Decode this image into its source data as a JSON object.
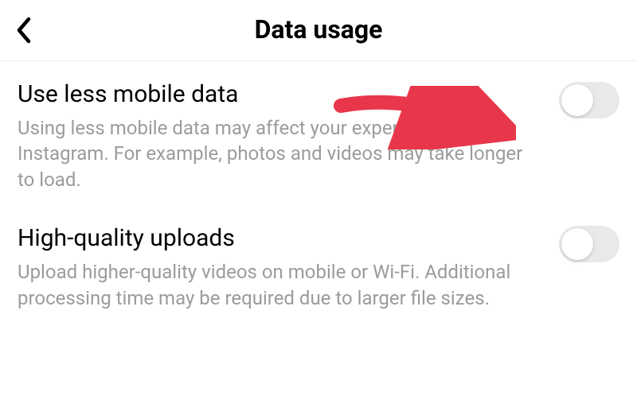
{
  "header": {
    "title": "Data usage"
  },
  "settings": [
    {
      "title": "Use less mobile data",
      "description": "Using less mobile data may affect your experience on Instagram. For example, photos and videos may take longer to load.",
      "enabled": false
    },
    {
      "title": "High-quality uploads",
      "description": "Upload higher-quality videos on mobile or Wi-Fi. Additional processing time may be required due to larger file sizes.",
      "enabled": false
    }
  ],
  "annotation": {
    "type": "arrow",
    "color": "#e8374a"
  }
}
